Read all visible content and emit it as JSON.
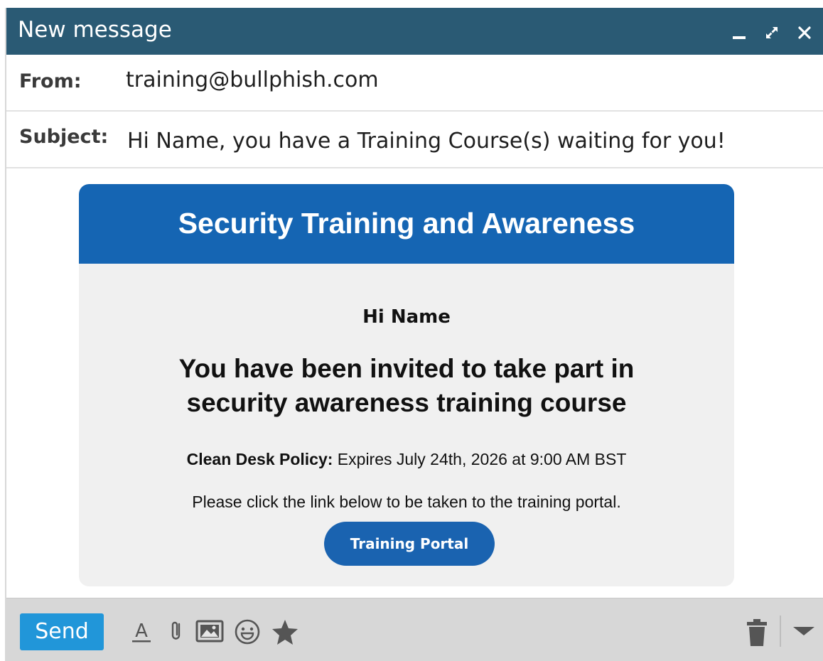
{
  "window": {
    "title": "New message"
  },
  "header": {
    "from_label": "From:",
    "from_value": "training@bullphish.com",
    "subject_label": "Subject:",
    "subject_value": "Hi Name, you have a Training Course(s) waiting for you!"
  },
  "email": {
    "banner_title": "Security Training and Awareness",
    "greeting": "Hi Name",
    "headline_line1": "You have been invited to take part in",
    "headline_line2": "security awareness training course",
    "policy_label": "Clean Desk Policy:",
    "policy_text": " Expires July 24th, 2026 at 9:00 AM BST",
    "instruction": "Please click the link below to be taken to the training portal.",
    "button_label": "Training Portal"
  },
  "toolbar": {
    "send_label": "Send",
    "icons": [
      "format-text-icon",
      "attachment-icon",
      "image-icon",
      "emoji-icon",
      "star-icon",
      "trash-icon",
      "dropdown-arrow-icon"
    ]
  },
  "colors": {
    "titlebar": "#2a5a74",
    "banner": "#1565b3",
    "button": "#1a63b0",
    "send": "#2196d9",
    "toolbar": "#d7d7d7",
    "card": "#f0f0f0"
  }
}
